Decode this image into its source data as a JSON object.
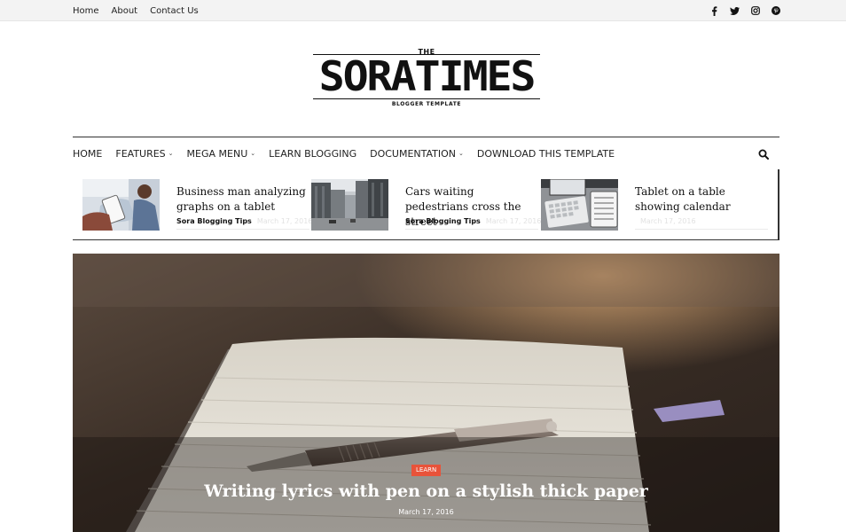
{
  "topbar": {
    "links": [
      "Home",
      "About",
      "Contact Us"
    ],
    "social_icons": [
      "facebook-icon",
      "twitter-icon",
      "instagram-icon",
      "pinterest-icon"
    ]
  },
  "logo": {
    "the": "THE",
    "name": "SORATIMES",
    "subtitle": "BLOGGER TEMPLATE"
  },
  "nav": {
    "items": [
      {
        "label": "HOME",
        "dropdown": false
      },
      {
        "label": "FEATURES",
        "dropdown": true
      },
      {
        "label": "MEGA MENU",
        "dropdown": true
      },
      {
        "label": "LEARN BLOGGING",
        "dropdown": false
      },
      {
        "label": "DOCUMENTATION",
        "dropdown": true
      },
      {
        "label": "DOWNLOAD THIS TEMPLATE",
        "dropdown": false
      }
    ],
    "search_icon": "search-icon"
  },
  "featured": [
    {
      "title": "Business man analyzing graphs on a tablet",
      "label": "Sora Blogging Tips",
      "date": "March 17, 2016"
    },
    {
      "title": "Cars waiting pedestrians cross the street",
      "label": "Sora Blogging Tips",
      "date": "March 17, 2016"
    },
    {
      "title": "Tablet on a table showing calendar",
      "label": "",
      "date": "March 17, 2016"
    }
  ],
  "hero": {
    "badge": "LEARN",
    "title": "Writing lyrics with pen on a stylish thick paper",
    "date": "March 17, 2016"
  },
  "colors": {
    "accent": "#e8533a",
    "text": "#222222",
    "topbar_bg": "#f3f3f3"
  }
}
